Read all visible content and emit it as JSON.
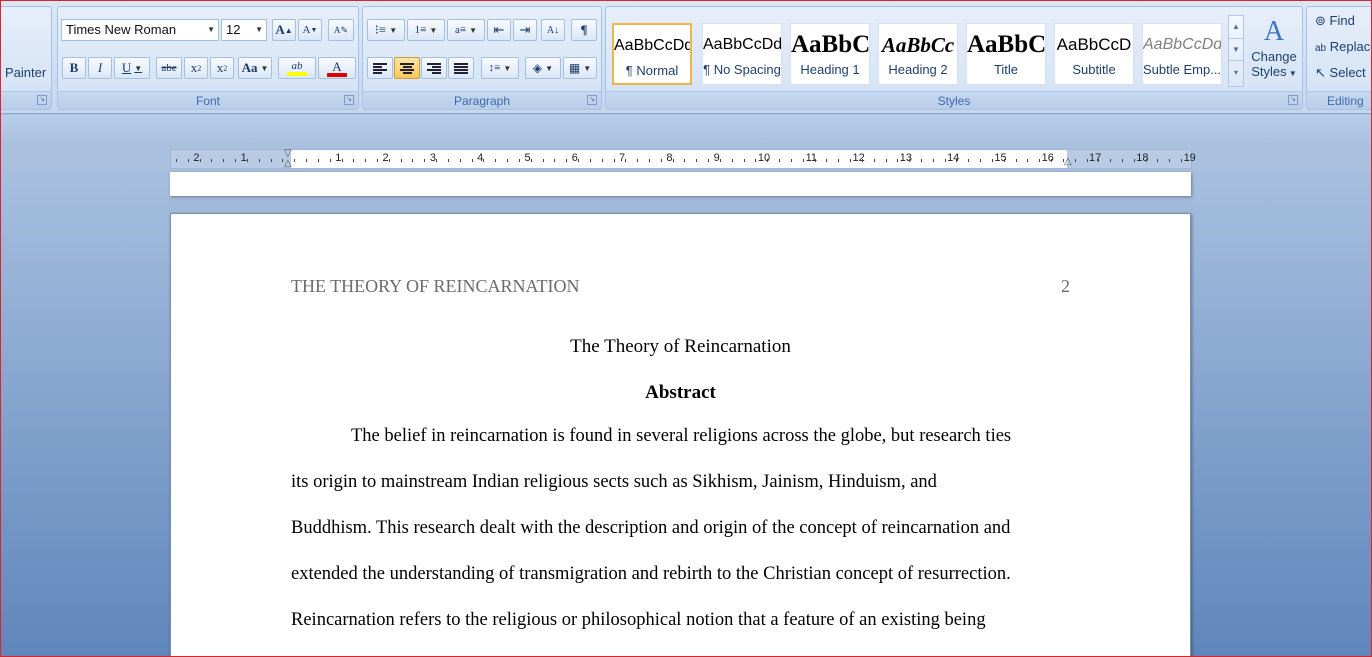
{
  "clipboard": {
    "painter_label": "Painter"
  },
  "font_group": {
    "label": "Font",
    "font_name": "Times New Roman",
    "font_size": "12",
    "grow_label": "A",
    "shrink_label": "A",
    "bold": "B",
    "italic": "I",
    "underline": "U",
    "strike": "abe",
    "subscript": "x",
    "superscript": "x",
    "change_case": "Aa",
    "highlight": "ab",
    "font_color": "A",
    "highlight_color": "#ffff00",
    "font_color_value": "#e00000"
  },
  "paragraph_group": {
    "label": "Paragraph",
    "show_marks": "¶"
  },
  "styles_group": {
    "label": "Styles",
    "items": [
      {
        "sample": "AaBbCcDd",
        "name": "¶ Normal"
      },
      {
        "sample": "AaBbCcDd",
        "name": "¶ No Spacing"
      },
      {
        "sample": "AaBbC",
        "name": "Heading 1"
      },
      {
        "sample": "AaBbCc",
        "name": "Heading 2"
      },
      {
        "sample": "AaBbC",
        "name": "Title"
      },
      {
        "sample": "AaBbCcD",
        "name": "Subtitle"
      },
      {
        "sample": "AaBbCcDd",
        "name": "Subtle Emp..."
      }
    ],
    "change_styles_line1": "Change",
    "change_styles_line2": "Styles"
  },
  "editing_group": {
    "label": "Editing",
    "find": "Find",
    "replace": "Replace",
    "select": "Select"
  },
  "ruler": {
    "left_numbers": [
      "2",
      "1"
    ],
    "right_numbers": [
      "1",
      "2",
      "3",
      "4",
      "5",
      "6",
      "7",
      "8",
      "9",
      "10",
      "11",
      "12",
      "13",
      "14",
      "15",
      "16",
      "17",
      "18",
      "19"
    ]
  },
  "document": {
    "running_head": "THE THEORY OF REINCARNATION",
    "page_number": "2",
    "title": "The Theory of Reincarnation",
    "abstract_heading": "Abstract",
    "lines": [
      "The belief in reincarnation is found in several religions across the globe, but research ties",
      "its origin to mainstream Indian religious sects such as Sikhism, Jainism, Hinduism, and",
      "Buddhism. This research dealt with the description and origin of the concept of reincarnation and",
      "extended the understanding of transmigration and rebirth to the Christian concept of resurrection.",
      "Reincarnation refers to the religious or philosophical notion that a feature of an existing being"
    ]
  }
}
